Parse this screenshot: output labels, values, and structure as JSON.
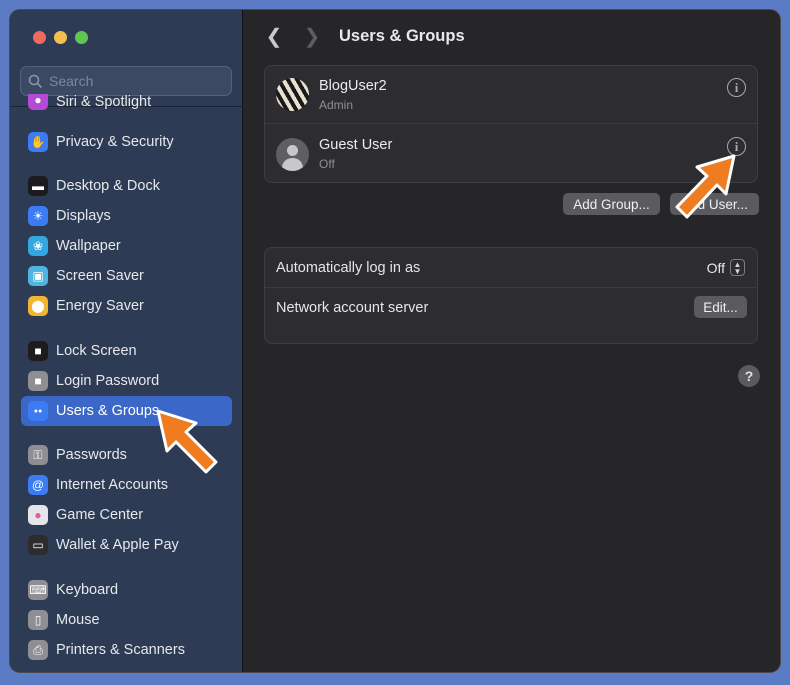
{
  "window": {
    "traffic_lights": [
      "close",
      "minimize",
      "zoom"
    ]
  },
  "sidebar": {
    "search_placeholder": "Search",
    "items": [
      {
        "label": "Siri & Spotlight",
        "icon": "siri-icon",
        "color": "#b44ad6"
      },
      {
        "label": "Privacy & Security",
        "icon": "hand-icon",
        "color": "#3b7cf5"
      },
      {
        "label": "Desktop & Dock",
        "icon": "dock-icon",
        "color": "#1c1c1e"
      },
      {
        "label": "Displays",
        "icon": "sun-icon",
        "color": "#3b7cf5"
      },
      {
        "label": "Wallpaper",
        "icon": "flower-icon",
        "color": "#34a7e0"
      },
      {
        "label": "Screen Saver",
        "icon": "screensaver-icon",
        "color": "#4fb4e0"
      },
      {
        "label": "Energy Saver",
        "icon": "bulb-icon",
        "color": "#f2b431"
      },
      {
        "label": "Lock Screen",
        "icon": "lock-icon",
        "color": "#1c1c1e"
      },
      {
        "label": "Login Password",
        "icon": "padlock-icon",
        "color": "#8e8e93"
      },
      {
        "label": "Users & Groups",
        "icon": "users-icon",
        "color": "#3b7cf5",
        "active": true
      },
      {
        "label": "Passwords",
        "icon": "key-icon",
        "color": "#8e8e93"
      },
      {
        "label": "Internet Accounts",
        "icon": "at-icon",
        "color": "#3b7cf5"
      },
      {
        "label": "Game Center",
        "icon": "gamecenter-icon",
        "color": "#e5e5ea"
      },
      {
        "label": "Wallet & Apple Pay",
        "icon": "wallet-icon",
        "color": "#2c2c2e"
      },
      {
        "label": "Keyboard",
        "icon": "keyboard-icon",
        "color": "#8e8e93"
      },
      {
        "label": "Mouse",
        "icon": "mouse-icon",
        "color": "#8e8e93"
      },
      {
        "label": "Printers & Scanners",
        "icon": "printer-icon",
        "color": "#8e8e93"
      }
    ]
  },
  "header": {
    "title": "Users & Groups"
  },
  "users": [
    {
      "name": "BlogUser2",
      "role": "Admin"
    },
    {
      "name": "Guest User",
      "role": "Off"
    }
  ],
  "buttons": {
    "add_group": "Add Group...",
    "add_user": "Add User..."
  },
  "settings": {
    "auto_login_label": "Automatically log in as",
    "auto_login_value": "Off",
    "network_label": "Network account server",
    "edit_label": "Edit..."
  },
  "help": "?",
  "accent": "#3a67c8"
}
